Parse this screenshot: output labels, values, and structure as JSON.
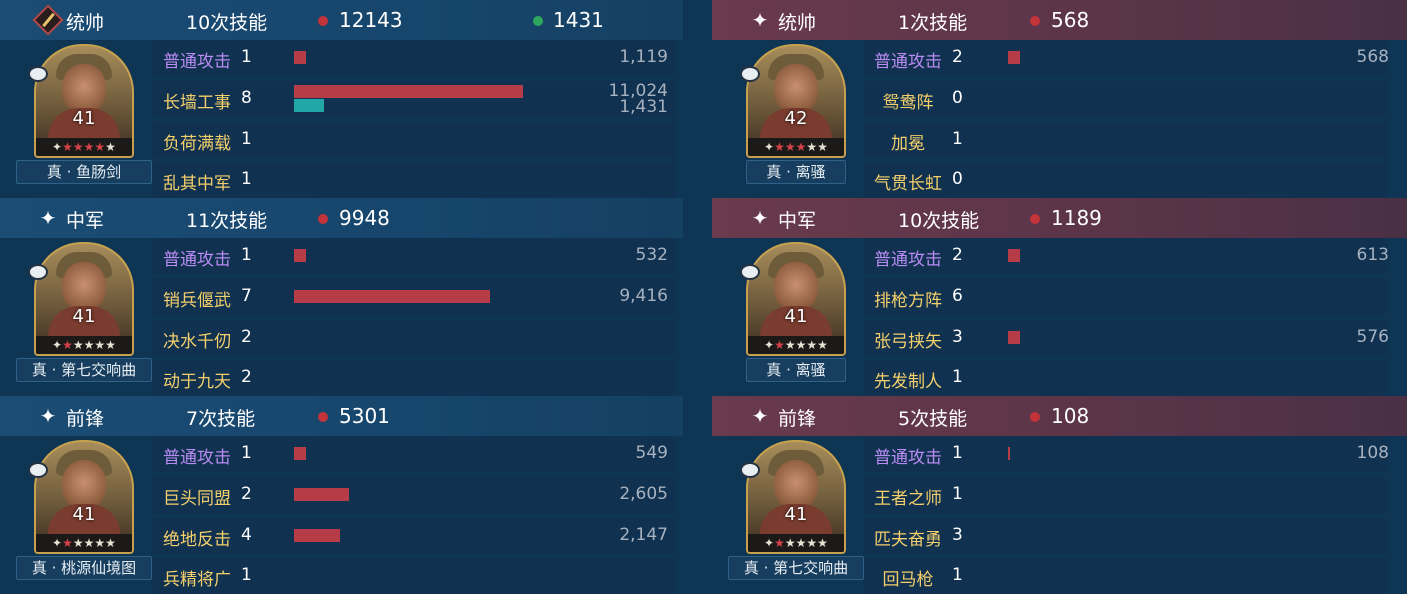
{
  "colors": {
    "ally_header": "#1b4c74",
    "enemy_header": "#6a3a4d",
    "damage_bar": "#b63c47",
    "heal_bar": "#23a7a6",
    "damage_dot": "#c4333a",
    "heal_dot": "#2fa85f",
    "basic_attack_text": "#b88cf2",
    "skill_text": "#f4cf6b"
  },
  "left": {
    "generals": [
      {
        "role": "统帅",
        "role_icon": "commander-diamond-icon",
        "casts": "10次技能",
        "damage": "12143",
        "heal": "1431",
        "level": "41",
        "stars_red": 4,
        "tactic": "真 · 鱼肠剑",
        "skills": [
          {
            "name": "普通攻击",
            "count": "1",
            "value": "1,119",
            "bar_fraction": 0.045,
            "basic": true
          },
          {
            "name": "长墙工事",
            "count": "8",
            "value": "11,024",
            "value2": "1,431",
            "bar_fraction": 0.88,
            "heal_fraction": 0.115
          },
          {
            "name": "负荷满载",
            "count": "1",
            "value": ""
          },
          {
            "name": "乱其中军",
            "count": "1",
            "value": ""
          }
        ]
      },
      {
        "role": "中军",
        "role_icon": "star-icon",
        "casts": "11次技能",
        "damage": "9948",
        "level": "41",
        "stars_red": 1,
        "tactic": "真 · 第七交响曲",
        "skills": [
          {
            "name": "普通攻击",
            "count": "1",
            "value": "532",
            "bar_fraction": 0.045,
            "basic": true
          },
          {
            "name": "销兵偃武",
            "count": "7",
            "value": "9,416",
            "bar_fraction": 0.755
          },
          {
            "name": "决水千仞",
            "count": "2",
            "value": ""
          },
          {
            "name": "动于九天",
            "count": "2",
            "value": ""
          }
        ]
      },
      {
        "role": "前锋",
        "role_icon": "star-icon",
        "casts": "7次技能",
        "damage": "5301",
        "level": "41",
        "stars_red": 1,
        "tactic": "真 · 桃源仙境图",
        "skills": [
          {
            "name": "普通攻击",
            "count": "1",
            "value": "549",
            "bar_fraction": 0.045,
            "basic": true
          },
          {
            "name": "巨头同盟",
            "count": "2",
            "value": "2,605",
            "bar_fraction": 0.21
          },
          {
            "name": "绝地反击",
            "count": "4",
            "value": "2,147",
            "bar_fraction": 0.175
          },
          {
            "name": "兵精将广",
            "count": "1",
            "value": ""
          }
        ]
      }
    ]
  },
  "right": {
    "generals": [
      {
        "role": "统帅",
        "role_icon": "star-icon",
        "casts": "1次技能",
        "damage": "568",
        "level": "42",
        "stars_red": 3,
        "tactic": "真 · 离骚",
        "skills": [
          {
            "name": "普通攻击",
            "count": "2",
            "value": "568",
            "bar_fraction": 0.045,
            "basic": true
          },
          {
            "name": "鸳鸯阵",
            "count": "0",
            "value": ""
          },
          {
            "name": "加冕",
            "count": "1",
            "value": ""
          },
          {
            "name": "气贯长虹",
            "count": "0",
            "value": ""
          }
        ]
      },
      {
        "role": "中军",
        "role_icon": "star-icon",
        "casts": "10次技能",
        "damage": "1189",
        "level": "41",
        "stars_red": 1,
        "tactic": "真 · 离骚",
        "skills": [
          {
            "name": "普通攻击",
            "count": "2",
            "value": "613",
            "bar_fraction": 0.045,
            "basic": true
          },
          {
            "name": "排枪方阵",
            "count": "6",
            "value": ""
          },
          {
            "name": "张弓挟矢",
            "count": "3",
            "value": "576",
            "bar_fraction": 0.045
          },
          {
            "name": "先发制人",
            "count": "1",
            "value": ""
          }
        ]
      },
      {
        "role": "前锋",
        "role_icon": "star-icon",
        "casts": "5次技能",
        "damage": "108",
        "level": "41",
        "stars_red": 1,
        "tactic": "真 · 第七交响曲",
        "skills": [
          {
            "name": "普通攻击",
            "count": "1",
            "value": "108",
            "bar_fraction": 0.008,
            "basic": true
          },
          {
            "name": "王者之师",
            "count": "1",
            "value": ""
          },
          {
            "name": "匹夫奋勇",
            "count": "3",
            "value": ""
          },
          {
            "name": "回马枪",
            "count": "1",
            "value": ""
          }
        ]
      }
    ]
  }
}
